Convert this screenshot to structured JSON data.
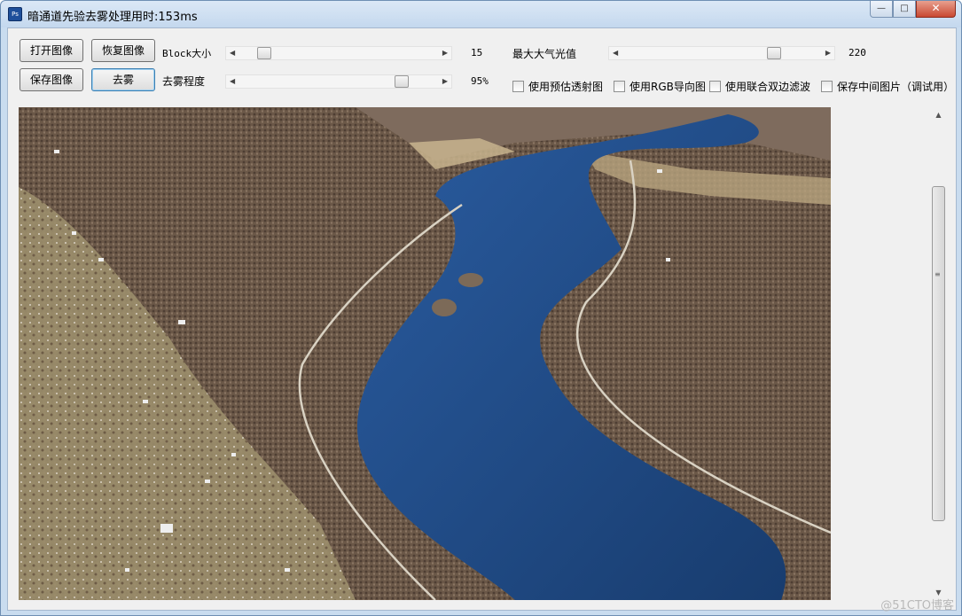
{
  "window": {
    "title": "暗通道先验去雾处理用时:153ms",
    "icon_label": "Ps",
    "controls": {
      "minimize": "—",
      "maximize": "□",
      "close": "✕"
    }
  },
  "toolbar": {
    "open_label": "打开图像",
    "restore_label": "恢复图像",
    "save_label": "保存图像",
    "dehaze_label": "去雾",
    "block_size_label": "Block大小",
    "block_size_value": "15",
    "dehaze_degree_label": "去雾程度",
    "dehaze_degree_value": "95%",
    "max_atmo_light_label": "最大大气光值",
    "max_atmo_light_value": "220"
  },
  "sliders": {
    "block_size": {
      "level": 0.1
    },
    "dehaze_degree": {
      "level": 0.84
    },
    "max_atmo_light": {
      "level": 0.78
    }
  },
  "options": [
    {
      "label": "使用预估透射图",
      "checked": false
    },
    {
      "label": "使用RGB导向图",
      "checked": false
    },
    {
      "label": "使用联合双边滤波",
      "checked": false
    },
    {
      "label": "保存中间图片（调试用）",
      "checked": false
    }
  ],
  "scrollbar": {
    "up_arrow": "▲",
    "down_arrow": "▼",
    "grip": "≡"
  },
  "watermark": "@51CTO博客"
}
